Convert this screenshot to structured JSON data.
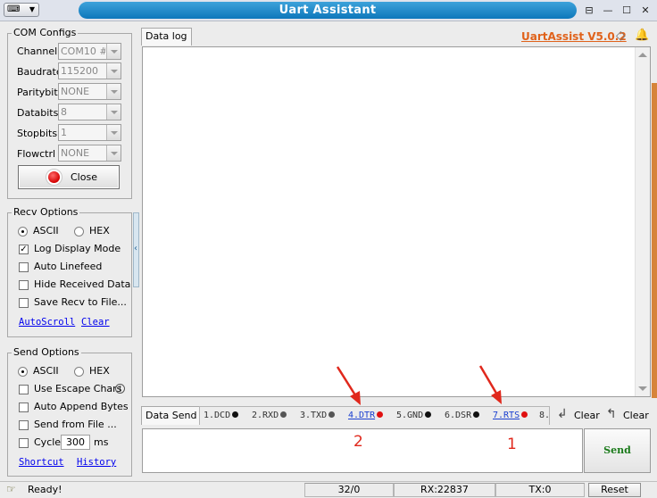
{
  "window": {
    "title": "Uart Assistant",
    "sysmenu_icon": "keyboard-icon",
    "controls": [
      "pin-icon",
      "minimize-icon",
      "maximize-icon",
      "close-icon"
    ]
  },
  "header": {
    "datalog_tab": "Data log",
    "version_link": "UartAssist V5.0.2"
  },
  "com_configs": {
    "title": "COM Configs",
    "fields": [
      {
        "label": "Channel",
        "value": "COM10 #U"
      },
      {
        "label": "Baudrate",
        "value": "115200"
      },
      {
        "label": "Paritybits",
        "value": "NONE"
      },
      {
        "label": "Databits",
        "value": "8"
      },
      {
        "label": "Stopbits",
        "value": "1"
      },
      {
        "label": "Flowctrl",
        "value": "NONE"
      }
    ],
    "close_button": "Close"
  },
  "recv_options": {
    "title": "Recv Options",
    "ascii": "ASCII",
    "hex": "HEX",
    "checks": [
      {
        "label": "Log Display Mode",
        "checked": true
      },
      {
        "label": "Auto Linefeed",
        "checked": false
      },
      {
        "label": "Hide Received Data",
        "checked": false
      },
      {
        "label": "Save Recv to File...",
        "checked": false
      }
    ],
    "autoscroll": "AutoScroll",
    "clear": "Clear"
  },
  "send_options": {
    "title": "Send Options",
    "ascii": "ASCII",
    "hex": "HEX",
    "checks": [
      {
        "label": "Use Escape Chars",
        "checked": false
      },
      {
        "label": "Auto Append Bytes",
        "checked": false
      },
      {
        "label": "Send from File ...",
        "checked": false
      },
      {
        "label": "Cycle",
        "checked": false
      }
    ],
    "cycle_value": "300",
    "cycle_unit": "ms",
    "shortcut": "Shortcut",
    "history": "History"
  },
  "send_bar": {
    "tab": "Data Send",
    "signals": [
      {
        "label": "1.DCD",
        "color": "#111111",
        "link": false
      },
      {
        "label": "2.RXD",
        "color": "#555555",
        "link": false
      },
      {
        "label": "3.TXD",
        "color": "#555555",
        "link": false
      },
      {
        "label": "4.DTR",
        "color": "#e01010",
        "link": true
      },
      {
        "label": "5.GND",
        "color": "#111111",
        "link": false
      },
      {
        "label": "6.DSR",
        "color": "#111111",
        "link": false
      },
      {
        "label": "7.RTS",
        "color": "#e01010",
        "link": true
      },
      {
        "label": "8.",
        "color": "",
        "link": false
      }
    ],
    "clear1": "Clear",
    "clear2": "Clear",
    "send_button": "Send"
  },
  "annotations": {
    "label_left": "2",
    "label_right": "1",
    "color": "#e0281c"
  },
  "statusbar": {
    "ready": "Ready!",
    "counter": "32/0",
    "rx": "RX:22837",
    "tx": "TX:0",
    "reset": "Reset"
  }
}
